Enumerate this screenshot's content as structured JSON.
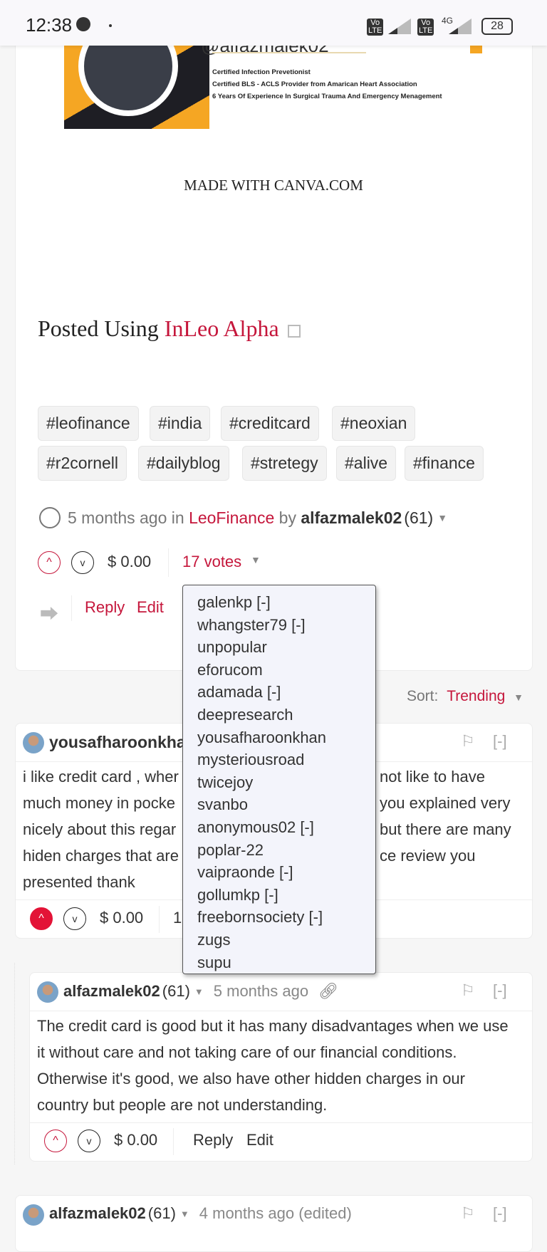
{
  "status_bar": {
    "time": "12:38",
    "battery": "28",
    "network": "4G"
  },
  "post": {
    "banner_lines": [
      "Certified Infection Prevetionist",
      "Certified BLS - ACLS Provider from Amarican Heart Association",
      "6 Years Of Experience In Surgical Trauma  And Emergency  Menagement"
    ],
    "banner_handle": "@alfazmalek02",
    "canva_credit": "MADE WITH CANVA.COM",
    "posted_using_prefix": "Posted Using ",
    "posted_using_link": "InLeo Alpha",
    "tags": [
      "#leofinance",
      "#india",
      "#creditcard",
      "#neoxian",
      "#r2cornell",
      "#dailyblog",
      "#stretegy",
      "#alive",
      "#finance"
    ],
    "meta": {
      "time": "5 months ago",
      "in": " in ",
      "community": "LeoFinance",
      "by": " by ",
      "author": "alfazmalek02",
      "reputation": "(61)"
    },
    "payout": "$ 0.00",
    "votes_label": "17 votes",
    "reply": "Reply",
    "edit": "Edit"
  },
  "votes_dropdown": [
    "galenkp [-]",
    "whangster79 [-]",
    "unpopular",
    "eforucom",
    "adamada [-]",
    "deepresearch",
    "yousafharoonkhan",
    "mysteriousroad",
    "twicejoy",
    "svanbo",
    "anonymous02 [-]",
    "poplar-22",
    "vaipraonde [-]",
    "gollumkp [-]",
    "freebornsociety [-]",
    "zugs",
    "supu"
  ],
  "sort": {
    "label": "Sort:",
    "value": "Trending"
  },
  "comments": [
    {
      "author": "yousafharoonkhan",
      "lines": [
        "i like credit card , wher",
        "much money in pocke",
        "nicely about this regar",
        "hiden charges that are",
        "presented thank"
      ],
      "lines_right": [
        "not like to have",
        "you explained very",
        "but there are many",
        "ce review you",
        ""
      ],
      "payout": "$ 0.00",
      "votes_partial": "1",
      "collapse": "[-]"
    },
    {
      "author": "alfazmalek02",
      "reputation": "(61)",
      "time": "5 months ago",
      "lines": [
        "The credit card is good but it has many disadvantages when we use",
        "it without care and not taking care of our financial conditions.",
        "Otherwise it's good, we also have other hidden charges in our",
        "country but people are not understanding."
      ],
      "payout": "$ 0.00",
      "reply": "Reply",
      "edit": "Edit",
      "collapse": "[-]"
    },
    {
      "author": "alfazmalek02",
      "reputation": "(61)",
      "time": "4 months ago (edited)",
      "collapse": "[-]"
    }
  ]
}
